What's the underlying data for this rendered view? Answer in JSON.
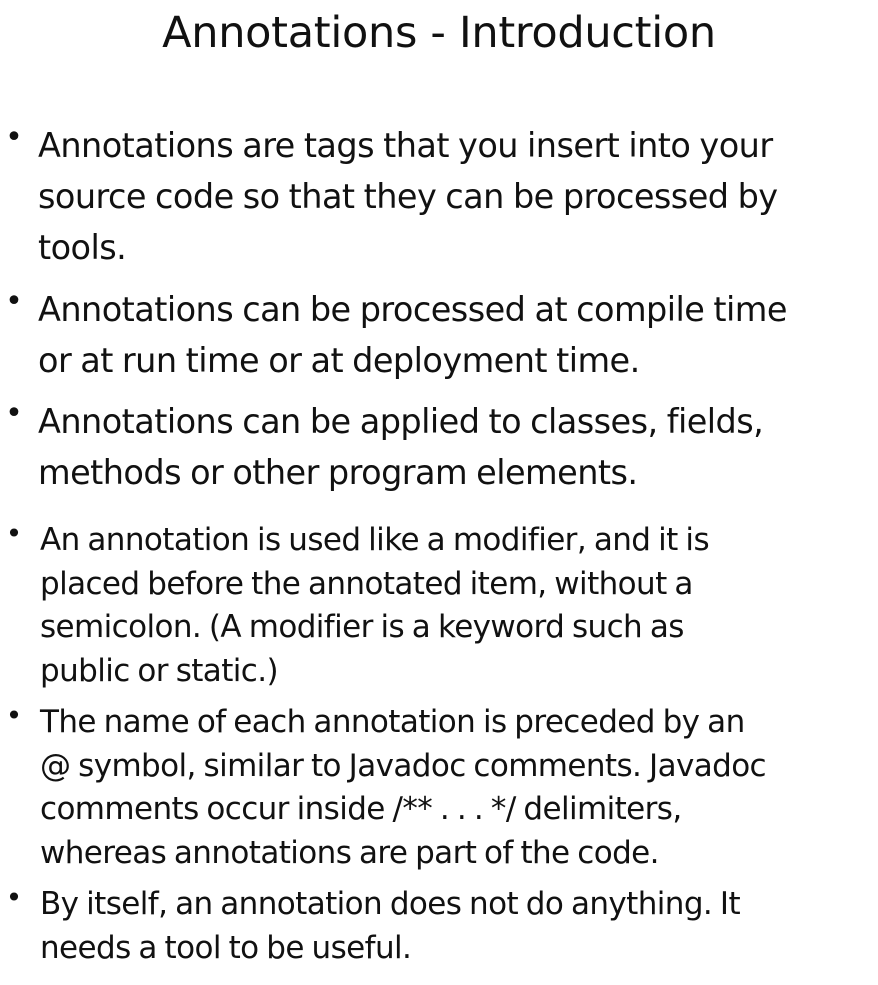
{
  "slide": {
    "title": "Annotations - Introduction",
    "bullet_symbol": "•",
    "bullets": [
      {
        "text": "Annotations are tags that you insert into your\nsource code so that they can be processed by\ntools."
      },
      {
        "text": "Annotations can be processed at compile time\nor at run time or at deployment time."
      },
      {
        "text": "Annotations can be applied to classes, fields,\nmethods or other program elements."
      },
      {
        "text": "An annotation is used like a modifier, and it is\nplaced before the annotated item, without a\nsemicolon. (A modifier is a keyword such as\npublic or static.)"
      },
      {
        "text": "The name of each annotation is preceded by an\n@ symbol, similar to Javadoc comments. Javadoc\ncomments occur inside /** . . . */ delimiters,\nwhereas annotations are part of the code."
      },
      {
        "text": "By itself,  an annotation does not do anything. It\nneeds a tool to be useful."
      }
    ]
  }
}
